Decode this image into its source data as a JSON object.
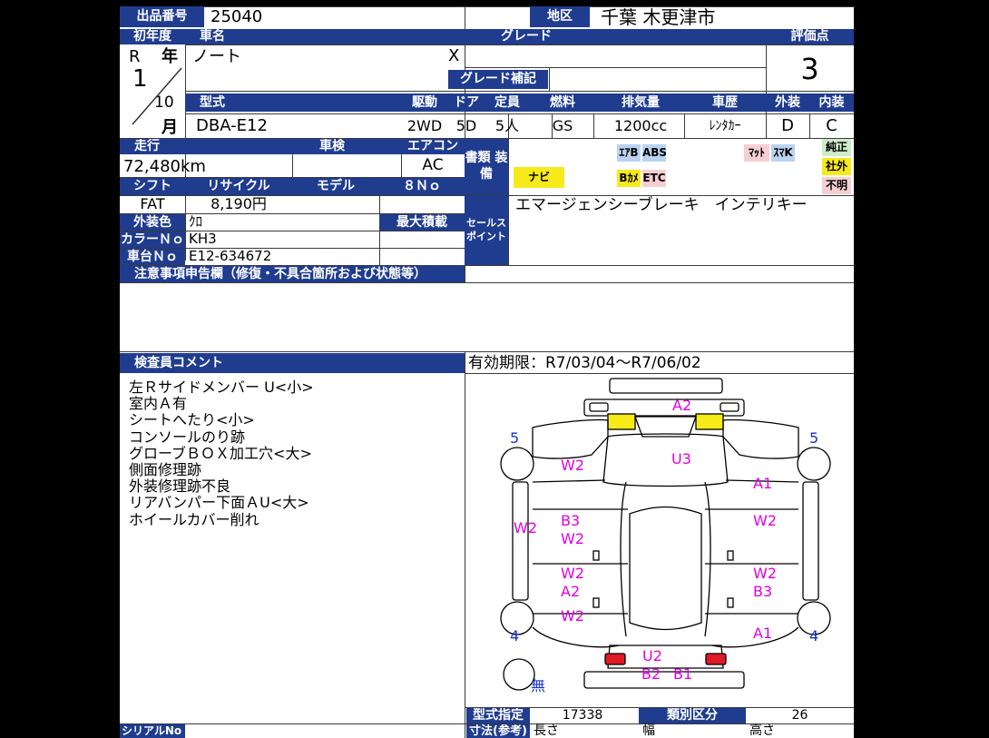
{
  "labels": {
    "lot_number": "出品番号",
    "region": "地区",
    "first_registration": "初年度",
    "car_name": "車名",
    "grade": "グレード",
    "score": "評価点",
    "grade_supplement": "グレード補記",
    "year_suffix": "年",
    "month_suffix": "月",
    "model_code": "型式",
    "drive": "駆動",
    "doors": "ドア",
    "capacity": "定員",
    "fuel": "燃料",
    "displacement": "排気量",
    "history": "車歴",
    "exterior": "外装",
    "interior": "内装",
    "mileage": "走行",
    "inspection": "車検",
    "aircon": "エアコン",
    "equipment": "書類 装備",
    "shift": "シフト",
    "recycle": "リサイクル",
    "model_year": "モデル",
    "chassis_short": "８Ｎｏ",
    "exterior_color": "外装色",
    "max_load": "最大積載",
    "color_no": "カラーＮｏ",
    "chassis_no": "車台Ｎｏ",
    "sales_points": "セールス ポイント",
    "notes": "注意事項申告欄（修復・不具合箇所および状態等）",
    "inspector_comment": "検査員コメント",
    "type_designation": "型式指定",
    "category": "類別区分",
    "dimensions": "寸法(参考)",
    "length": "長さ",
    "width": "幅",
    "height": "高さ",
    "serial_no": "シリアルNo"
  },
  "vehicle": {
    "lot_number": "25040",
    "region": "千葉 木更津市",
    "reg_era": "R",
    "reg_year": "1",
    "reg_month": "10",
    "car_name": "ノート",
    "grade": "X",
    "score": "3",
    "model_code": "DBA-E12",
    "drive": "2WD",
    "doors": "5D",
    "capacity": "5人",
    "fuel": "GS",
    "displacement": "1200cc",
    "history": "ﾚﾝﾀｶｰ",
    "exterior_grade": "D",
    "interior_grade": "C",
    "mileage": "72,480km",
    "aircon": "AC",
    "shift": "FAT",
    "recycle_fee": "8,190円",
    "exterior_color": "ｸﾛ",
    "color_no": "KH3",
    "chassis_no": "E12-634672",
    "sales_points": "エマージェンシーブレーキ　インテリキー",
    "validity": "有効期限：R7/03/04～R7/06/02",
    "type_designation": "17338",
    "category": "26"
  },
  "equipment": {
    "airbag": "ｴｱB",
    "abs": "ABS",
    "mat": "ﾏｯﾄ",
    "smart_key": "ｽﾏK",
    "navi": "ナビ",
    "back_camera": "Bｶﾒ",
    "etc": "ETC",
    "genuine": "純正",
    "aftermarket": "社外",
    "unknown": "不明"
  },
  "comments": [
    "左Ｒサイドメンバー U<小>",
    "室内Ａ有",
    "シートへたり<小>",
    "コンソールのり跡",
    "グローブＢＯＸ加工穴<大>",
    "側面修理跡",
    "外装修理跡不良",
    "リアバンパー下面ＡU<大>",
    "ホイールカバー削れ"
  ],
  "diagram": {
    "marks": [
      "A2",
      "U3",
      "W2",
      "A1",
      "W2",
      "B3",
      "W2",
      "W2",
      "W2",
      "A2",
      "W2",
      "B3",
      "W2",
      "A1",
      "U2",
      "B2",
      "B1"
    ],
    "tires": [
      "5",
      "5",
      "4",
      "4"
    ],
    "spare": "無"
  },
  "colors": {
    "header_blue": "#1f3c8f",
    "damage_magenta": "#e000e0",
    "tire_blue": "#1733c8",
    "badge_yellow": "#f7ea1b",
    "badge_pink": "#f6cfd2",
    "badge_blue": "#b9d3f0",
    "badge_green": "#cdecc9"
  }
}
